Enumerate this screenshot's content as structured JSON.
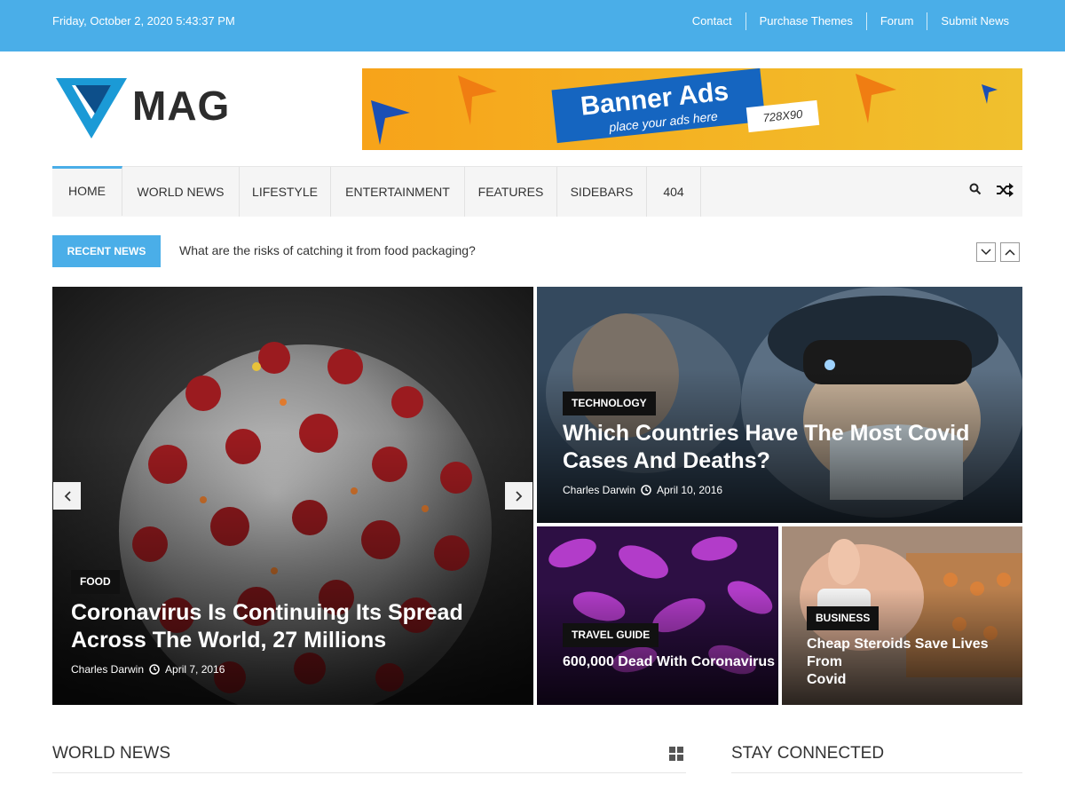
{
  "topbar": {
    "datetime": "Friday, October 2, 2020 5:43:37 PM",
    "links": [
      "Contact",
      "Purchase Themes",
      "Forum",
      "Submit News"
    ]
  },
  "logo": {
    "text": "MAG",
    "mark_color": "#1b9ad6"
  },
  "banner": {
    "title": "Banner Ads",
    "subtitle": "place your ads here",
    "size": "728X90"
  },
  "nav": {
    "items": [
      "HOME",
      "WORLD NEWS",
      "LIFESTYLE",
      "ENTERTAINMENT",
      "FEATURES",
      "SIDEBARS",
      "404"
    ],
    "search_icon": "search-icon",
    "random_icon": "shuffle-icon"
  },
  "recent": {
    "label": "RECENT NEWS",
    "headline": "What are the risks of catching it from food packaging?"
  },
  "featured": {
    "main": {
      "category": "FOOD",
      "title_line1": "Coronavirus Is Continuing Its Spread",
      "title_line2": "Across The World, 27 Millions",
      "author": "Charles Darwin",
      "date": "April 7, 2016"
    },
    "top_right": {
      "category": "TECHNOLOGY",
      "title_line1": "Which Countries Have The Most Covid",
      "title_line2": "Cases And Deaths?",
      "author": "Charles Darwin",
      "date": "April 10, 2016"
    },
    "bottom_left": {
      "category": "TRAVEL GUIDE",
      "title": "600,000 Dead With Coronavirus"
    },
    "bottom_right": {
      "category": "BUSINESS",
      "title_line1": "Cheap Steroids Save Lives From",
      "title_line2": "Covid"
    }
  },
  "sections": {
    "world_news": "WORLD NEWS",
    "stay_connected": "STAY CONNECTED"
  },
  "colors": {
    "accent": "#4aaee8"
  }
}
